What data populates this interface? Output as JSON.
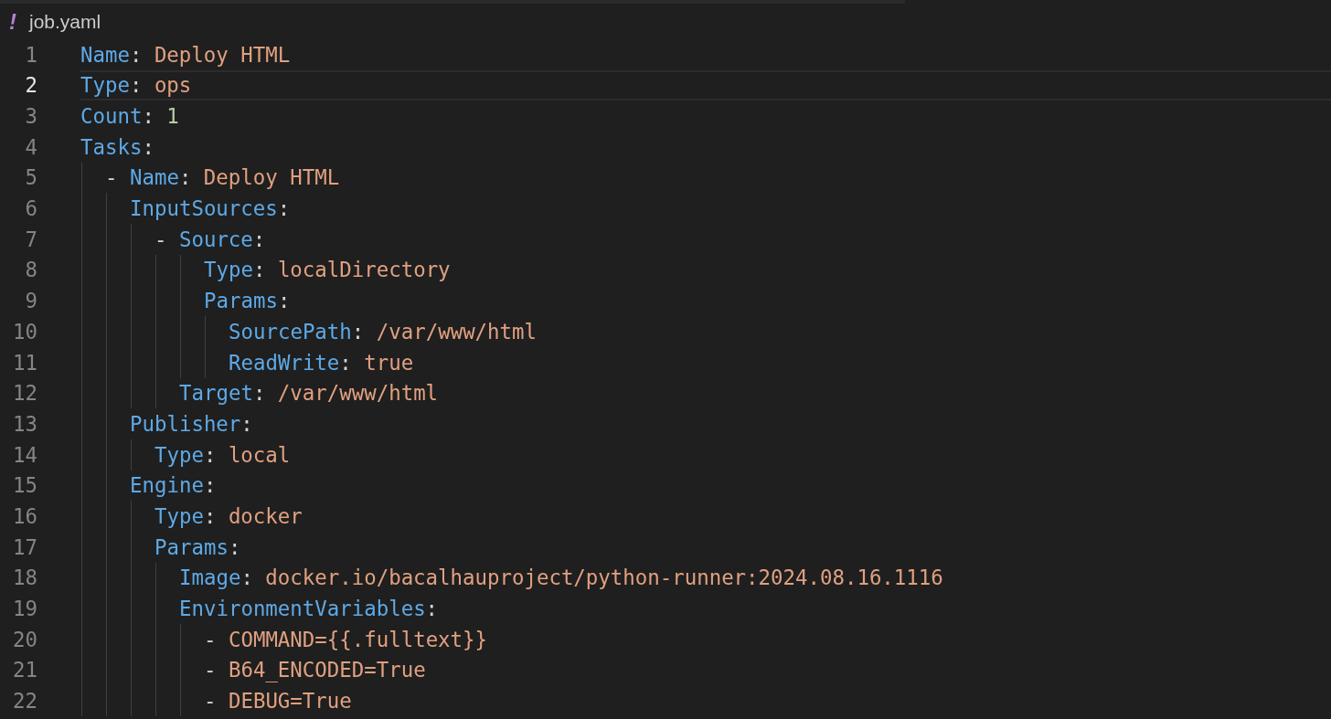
{
  "tab": {
    "icon_glyph": "!",
    "title": "job.yaml"
  },
  "lines": [
    {
      "number": "1",
      "current": false,
      "tokens": [
        {
          "kind": "key",
          "text": "Name"
        },
        {
          "kind": "colon",
          "text": ":"
        },
        {
          "kind": "string",
          "text": "Deploy HTML"
        }
      ]
    },
    {
      "number": "2",
      "current": true,
      "tokens": [
        {
          "kind": "key",
          "text": "Type"
        },
        {
          "kind": "colon",
          "text": ":"
        },
        {
          "kind": "string",
          "text": "ops"
        }
      ]
    },
    {
      "number": "3",
      "current": false,
      "tokens": [
        {
          "kind": "key",
          "text": "Count"
        },
        {
          "kind": "colon",
          "text": ":"
        },
        {
          "kind": "number",
          "text": "1"
        }
      ]
    },
    {
      "number": "4",
      "current": false,
      "tokens": [
        {
          "kind": "key",
          "text": "Tasks"
        },
        {
          "kind": "colon",
          "text": ":"
        }
      ],
      "children": [
        {
          "number": "5",
          "current": false,
          "tokens": [
            {
              "kind": "dash",
              "text": "-"
            },
            {
              "kind": "key",
              "text": "Name"
            },
            {
              "kind": "colon",
              "text": ":"
            },
            {
              "kind": "string",
              "text": "Deploy HTML"
            }
          ],
          "children": [
            {
              "number": "6",
              "current": false,
              "tokens": [
                {
                  "kind": "key",
                  "text": "InputSources"
                },
                {
                  "kind": "colon",
                  "text": ":"
                }
              ],
              "children": [
                {
                  "number": "7",
                  "current": false,
                  "tokens": [
                    {
                      "kind": "dash",
                      "text": "-"
                    },
                    {
                      "kind": "key",
                      "text": "Source"
                    },
                    {
                      "kind": "colon",
                      "text": ":"
                    }
                  ],
                  "value_children": [
                    {
                      "number": "8",
                      "current": false,
                      "tokens": [
                        {
                          "kind": "key",
                          "text": "Type"
                        },
                        {
                          "kind": "colon",
                          "text": ":"
                        },
                        {
                          "kind": "string",
                          "text": "localDirectory"
                        }
                      ]
                    },
                    {
                      "number": "9",
                      "current": false,
                      "tokens": [
                        {
                          "kind": "key",
                          "text": "Params"
                        },
                        {
                          "kind": "colon",
                          "text": ":"
                        }
                      ],
                      "children": [
                        {
                          "number": "10",
                          "current": false,
                          "tokens": [
                            {
                              "kind": "key",
                              "text": "SourcePath"
                            },
                            {
                              "kind": "colon",
                              "text": ":"
                            },
                            {
                              "kind": "string",
                              "text": "/var/www/html"
                            }
                          ]
                        },
                        {
                          "number": "11",
                          "current": false,
                          "tokens": [
                            {
                              "kind": "key",
                              "text": "ReadWrite"
                            },
                            {
                              "kind": "colon",
                              "text": ":"
                            },
                            {
                              "kind": "string",
                              "text": "true"
                            }
                          ]
                        }
                      ]
                    }
                  ],
                  "children": [
                    {
                      "number": "12",
                      "current": false,
                      "tokens": [
                        {
                          "kind": "key",
                          "text": "Target"
                        },
                        {
                          "kind": "colon",
                          "text": ":"
                        },
                        {
                          "kind": "string",
                          "text": "/var/www/html"
                        }
                      ]
                    }
                  ]
                }
              ]
            },
            {
              "number": "13",
              "current": false,
              "tokens": [
                {
                  "kind": "key",
                  "text": "Publisher"
                },
                {
                  "kind": "colon",
                  "text": ":"
                }
              ],
              "children": [
                {
                  "number": "14",
                  "current": false,
                  "tokens": [
                    {
                      "kind": "key",
                      "text": "Type"
                    },
                    {
                      "kind": "colon",
                      "text": ":"
                    },
                    {
                      "kind": "string",
                      "text": "local"
                    }
                  ]
                }
              ]
            },
            {
              "number": "15",
              "current": false,
              "tokens": [
                {
                  "kind": "key",
                  "text": "Engine"
                },
                {
                  "kind": "colon",
                  "text": ":"
                }
              ],
              "children": [
                {
                  "number": "16",
                  "current": false,
                  "tokens": [
                    {
                      "kind": "key",
                      "text": "Type"
                    },
                    {
                      "kind": "colon",
                      "text": ":"
                    },
                    {
                      "kind": "string",
                      "text": "docker"
                    }
                  ]
                },
                {
                  "number": "17",
                  "current": false,
                  "tokens": [
                    {
                      "kind": "key",
                      "text": "Params"
                    },
                    {
                      "kind": "colon",
                      "text": ":"
                    }
                  ],
                  "children": [
                    {
                      "number": "18",
                      "current": false,
                      "tokens": [
                        {
                          "kind": "key",
                          "text": "Image"
                        },
                        {
                          "kind": "colon",
                          "text": ":"
                        },
                        {
                          "kind": "string",
                          "text": "docker.io/bacalhauproject/python-runner:2024.08.16.1116"
                        }
                      ]
                    },
                    {
                      "number": "19",
                      "current": false,
                      "tokens": [
                        {
                          "kind": "key",
                          "text": "EnvironmentVariables"
                        },
                        {
                          "kind": "colon",
                          "text": ":"
                        }
                      ],
                      "children": [
                        {
                          "number": "20",
                          "current": false,
                          "tokens": [
                            {
                              "kind": "dash",
                              "text": "-"
                            },
                            {
                              "kind": "string",
                              "text": "COMMAND={{.fulltext}}"
                            }
                          ]
                        },
                        {
                          "number": "21",
                          "current": false,
                          "tokens": [
                            {
                              "kind": "dash",
                              "text": "-"
                            },
                            {
                              "kind": "string",
                              "text": "B64_ENCODED=True"
                            }
                          ]
                        },
                        {
                          "number": "22",
                          "current": false,
                          "tokens": [
                            {
                              "kind": "dash",
                              "text": "-"
                            },
                            {
                              "kind": "string",
                              "text": "DEBUG=True"
                            }
                          ]
                        }
                      ]
                    }
                  ]
                }
              ]
            }
          ]
        }
      ]
    }
  ]
}
